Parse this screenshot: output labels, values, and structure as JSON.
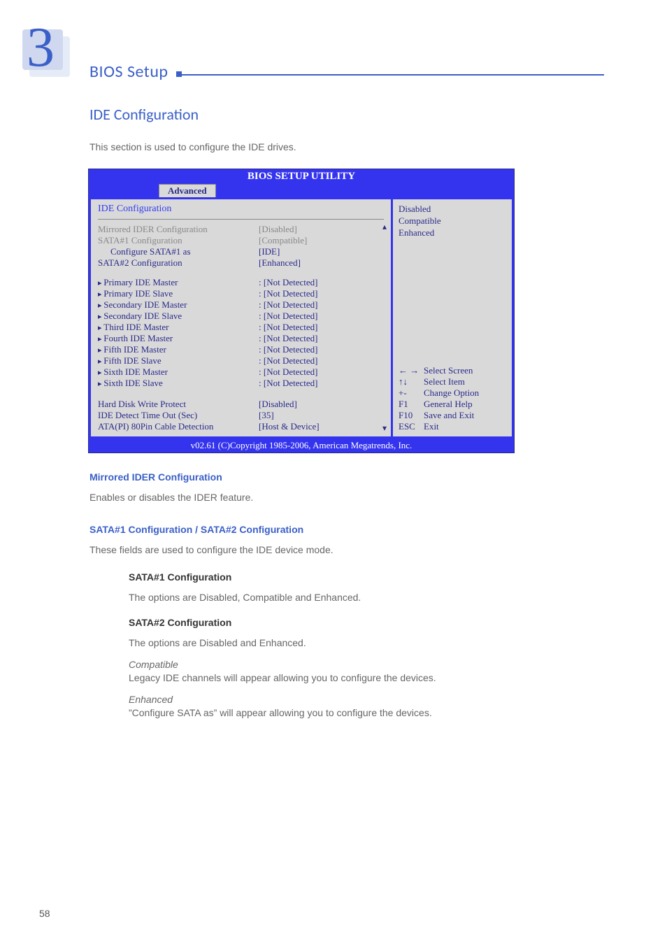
{
  "page": {
    "chapter_num": "3",
    "section_label": "BIOS Setup",
    "page_number": "58"
  },
  "heading": "IDE Configuration",
  "intro": "This section is used to configure the IDE drives.",
  "bios": {
    "title": "BIOS SETUP UTILITY",
    "tab": "Advanced",
    "panel_header": "IDE Configuration",
    "config": {
      "mirrored_label": "Mirrored IDER Configuration",
      "mirrored_value": "[Disabled]",
      "sata1_label": "SATA#1 Configuration",
      "sata1_value": "[Compatible]",
      "sata1_as_label": "Configure SATA#1 as",
      "sata1_as_value": "[IDE]",
      "sata2_label": "SATA#2 Configuration",
      "sata2_value": "[Enhanced]"
    },
    "ide_items": [
      {
        "label": "Primary IDE Master",
        "value": ": [Not Detected]"
      },
      {
        "label": "Primary IDE Slave",
        "value": ": [Not Detected]"
      },
      {
        "label": "Secondary IDE Master",
        "value": ": [Not Detected]"
      },
      {
        "label": "Secondary IDE Slave",
        "value": ": [Not Detected]"
      },
      {
        "label": "Third IDE Master",
        "value": ": [Not Detected]"
      },
      {
        "label": "Fourth IDE Master",
        "value": ": [Not Detected]"
      },
      {
        "label": "Fifth IDE Master",
        "value": ": [Not Detected]"
      },
      {
        "label": "Fifth IDE Slave",
        "value": ": [Not Detected]"
      },
      {
        "label": "Sixth IDE Master",
        "value": ": [Not Detected]"
      },
      {
        "label": "Sixth IDE Slave",
        "value": ": [Not Detected]"
      }
    ],
    "more": [
      {
        "label": "Hard Disk Write Protect",
        "value": "[Disabled]"
      },
      {
        "label": "IDE Detect Time Out (Sec)",
        "value": "[35]"
      },
      {
        "label": "ATA(PI) 80Pin Cable Detection",
        "value": "[Host & Device]"
      }
    ],
    "help_top": [
      "Disabled",
      "Compatible",
      "Enhanced"
    ],
    "nav": [
      {
        "key": "← →",
        "label": "Select Screen"
      },
      {
        "key": "↑↓",
        "label": "Select Item"
      },
      {
        "key": "+-",
        "label": "Change Option"
      },
      {
        "key": "F1",
        "label": "General Help"
      },
      {
        "key": "F10",
        "label": "Save and Exit"
      },
      {
        "key": "ESC",
        "label": "Exit"
      }
    ],
    "footer": "v02.61 (C)Copyright 1985-2006, American Megatrends, Inc."
  },
  "sections": {
    "mirrored_title": "Mirrored IDER Configuration",
    "mirrored_body": "Enables or disables the IDER feature.",
    "sata_title": "SATA#1 Configuration / SATA#2 Configuration",
    "sata_body": "These fields are used to configure the IDE device mode.",
    "sata1_sub": "SATA#1 Configuration",
    "sata1_sub_body": "The options are Disabled, Compatible and Enhanced.",
    "sata2_sub": "SATA#2 Configuration",
    "sata2_sub_body": "The options are Disabled and Enhanced.",
    "compat_label": "Compatible",
    "compat_body": "Legacy IDE channels will appear allowing you to configure the devices.",
    "enh_label": "Enhanced",
    "enh_body": "”Configure SATA as” will appear allowing you to configure the devices."
  }
}
